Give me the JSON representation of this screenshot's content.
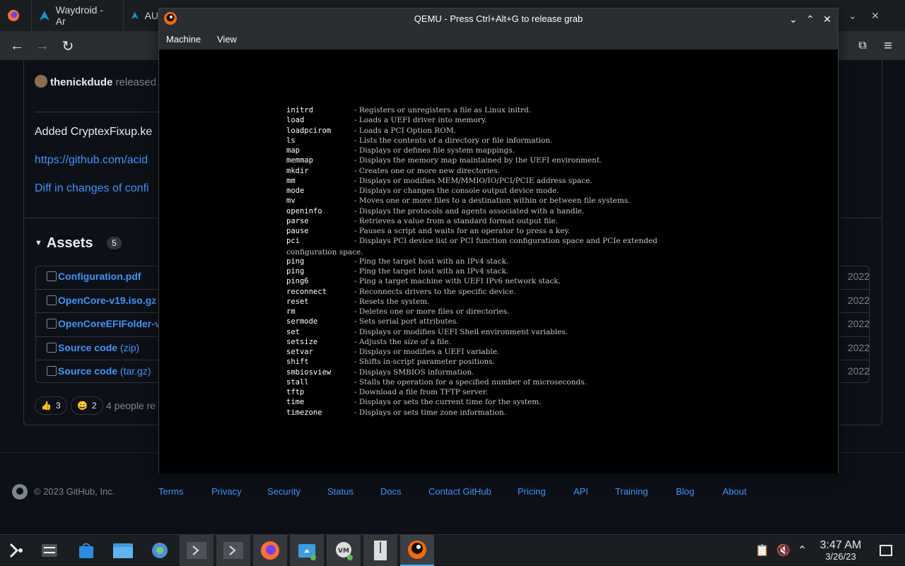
{
  "browser": {
    "tabs": [
      {
        "label": "Waydroid - Ar"
      },
      {
        "label": "AU"
      }
    ]
  },
  "github": {
    "release_author": "thenickdude",
    "release_verb": "released",
    "body_line": "Added CryptexFixup.ke",
    "link1": "https://github.com/acid",
    "link2": "Diff in changes of confi",
    "assets_title": "Assets",
    "assets_count": "5",
    "assets": [
      {
        "name": "Configuration.pdf",
        "suffix": "",
        "date": "2022"
      },
      {
        "name": "OpenCore-v19.iso.gz",
        "suffix": "",
        "date": "2022"
      },
      {
        "name": "OpenCoreEFIFolder-v",
        "suffix": "",
        "date": "2022"
      },
      {
        "name": "Source code",
        "suffix": "(zip)",
        "date": "2022"
      },
      {
        "name": "Source code",
        "suffix": "(tar.gz)",
        "date": "2022"
      }
    ],
    "reactions": [
      {
        "emoji": "👍",
        "count": "3"
      },
      {
        "emoji": "😄",
        "count": "2"
      }
    ],
    "reactions_text": "4 people re",
    "footer": {
      "copyright": "© 2023 GitHub, Inc.",
      "links": [
        "Terms",
        "Privacy",
        "Security",
        "Status",
        "Docs",
        "Contact GitHub",
        "Pricing",
        "API",
        "Training",
        "Blog",
        "About"
      ]
    }
  },
  "qemu": {
    "title": "QEMU - Press Ctrl+Alt+G to release grab",
    "menu": [
      "Machine",
      "View"
    ],
    "lines": [
      {
        "cmd": "initrd",
        "desc": "- Registers or unregisters a file as Linux initrd."
      },
      {
        "cmd": "load",
        "desc": "- Loads a UEFI driver into memory."
      },
      {
        "cmd": "loadpcirom",
        "desc": "- Loads a PCI Option ROM."
      },
      {
        "cmd": "ls",
        "desc": "- Lists the contents of a directory or file information."
      },
      {
        "cmd": "map",
        "desc": "- Displays or defines file system mappings."
      },
      {
        "cmd": "memmap",
        "desc": "- Displays the memory map maintained by the UEFI environment."
      },
      {
        "cmd": "mkdir",
        "desc": "- Creates one or more new directories."
      },
      {
        "cmd": "mm",
        "desc": "- Displays or modifies MEM/MMIO/IO/PCI/PCIE address space."
      },
      {
        "cmd": "mode",
        "desc": "- Displays or changes the console output device mode."
      },
      {
        "cmd": "mv",
        "desc": "- Moves one or more files to a destination within or between file systems."
      },
      {
        "cmd": "openinfo",
        "desc": "- Displays the protocols and agents associated with a handle."
      },
      {
        "cmd": "parse",
        "desc": "- Retrieves a value from a standard format output file."
      },
      {
        "cmd": "pause",
        "desc": "- Pauses a script and waits for an operator to press a key."
      },
      {
        "cmd": "pci",
        "desc": "- Displays PCI device list or PCI function configuration space and PCIe extended"
      },
      {
        "cmd": "",
        "desc": "configuration space."
      },
      {
        "cmd": "ping",
        "desc": "- Ping the target host with an IPv4 stack."
      },
      {
        "cmd": "ping",
        "desc": "- Ping the target host with an IPv4 stack."
      },
      {
        "cmd": "ping6",
        "desc": "- Ping a target machine with UEFI IPv6 network stack."
      },
      {
        "cmd": "reconnect",
        "desc": "- Reconnects drivers to the specific device."
      },
      {
        "cmd": "reset",
        "desc": "- Resets the system."
      },
      {
        "cmd": "rm",
        "desc": "- Deletes one or more files or directories."
      },
      {
        "cmd": "sermode",
        "desc": "- Sets serial port attributes."
      },
      {
        "cmd": "set",
        "desc": "- Displays or modifies UEFI Shell environment variables."
      },
      {
        "cmd": "setsize",
        "desc": "- Adjusts the size of a file."
      },
      {
        "cmd": "setvar",
        "desc": "- Displays or modifies a UEFI variable."
      },
      {
        "cmd": "shift",
        "desc": "- Shifts in-script parameter positions."
      },
      {
        "cmd": "smbiosview",
        "desc": "- Displays SMBIOS information."
      },
      {
        "cmd": "stall",
        "desc": "- Stalls the operation for a specified number of microseconds."
      },
      {
        "cmd": "tftp",
        "desc": "- Download a file from TFTP server."
      },
      {
        "cmd": "time",
        "desc": "- Displays or sets the current time for the system."
      },
      {
        "cmd": "timezone",
        "desc": "- Displays or sets time zone information."
      }
    ]
  },
  "taskbar": {
    "time": "3:47 AM",
    "date": "3/26/23"
  }
}
